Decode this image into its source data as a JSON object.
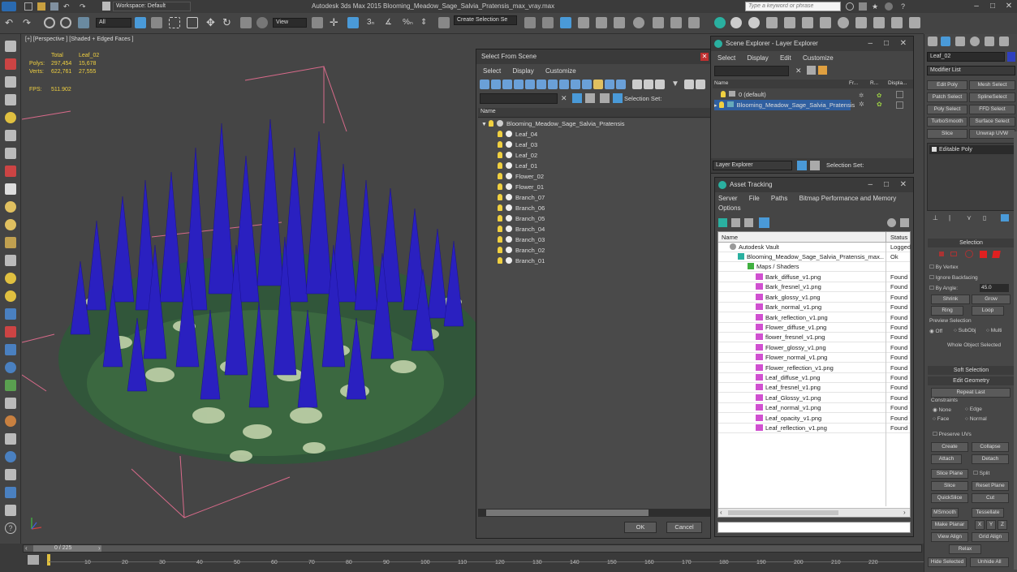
{
  "window": {
    "title": "Autodesk 3ds Max  2015     Blooming_Meadow_Sage_Salvia_Pratensis_max_vray.max",
    "search_placeholder": "Type a keyword or phrase",
    "workspace": "Workspace: Default"
  },
  "toolbar": {
    "filter_value": "All",
    "view_value": "View",
    "selection_set_placeholder": "Create Selection Se"
  },
  "viewport": {
    "label": "[+] [Perspective ] [Shaded + Edged Faces ]",
    "stats": {
      "total_header": "Total",
      "object_header": "Leaf_02",
      "polys_label": "Polys:",
      "polys_total": "297,454",
      "polys_object": "15,678",
      "verts_label": "Verts:",
      "verts_total": "622,761",
      "verts_object": "27,555",
      "fps_label": "FPS:",
      "fps_value": "511.902"
    }
  },
  "select_from_scene": {
    "title": "Select From Scene",
    "menu": [
      "Select",
      "Display",
      "Customize"
    ],
    "selection_set_label": "Selection Set:",
    "column_name": "Name",
    "root": "Blooming_Meadow_Sage_Salvia_Pratensis",
    "items": [
      "Leaf_04",
      "Leaf_03",
      "Leaf_02",
      "Leaf_01",
      "Flower_02",
      "Flower_01",
      "Branch_07",
      "Branch_06",
      "Branch_05",
      "Branch_04",
      "Branch_03",
      "Branch_02",
      "Branch_01"
    ],
    "ok": "OK",
    "cancel": "Cancel"
  },
  "scene_explorer": {
    "title": "Scene Explorer - Layer Explorer",
    "menu": [
      "Select",
      "Display",
      "Edit",
      "Customize"
    ],
    "col_name": "Name",
    "col_fr": "Fr...",
    "col_r": "R...",
    "col_disp": "Displa...",
    "rows": [
      "0 (default)",
      "Blooming_Meadow_Sage_Salvia_Pratensis"
    ],
    "footer_dropdown": "Layer Explorer",
    "selection_set_label": "Selection Set:"
  },
  "asset_tracking": {
    "title": "Asset Tracking",
    "menu": [
      "Server",
      "File",
      "Paths",
      "Bitmap Performance and Memory"
    ],
    "menu2": "Options",
    "col_name": "Name",
    "col_status": "Status",
    "vault": {
      "name": "Autodesk Vault",
      "status": "Logged"
    },
    "file": {
      "name": "Blooming_Meadow_Sage_Salvia_Pratensis_max...",
      "status": "Ok"
    },
    "maps_label": "Maps / Shaders",
    "maps": [
      {
        "name": "Bark_diffuse_v1.png",
        "status": "Found"
      },
      {
        "name": "Bark_fresnel_v1.png",
        "status": "Found"
      },
      {
        "name": "Bark_glossy_v1.png",
        "status": "Found"
      },
      {
        "name": "Bark_normal_v1.png",
        "status": "Found"
      },
      {
        "name": "Bark_reflection_v1.png",
        "status": "Found"
      },
      {
        "name": "Flower_diffuse_v1.png",
        "status": "Found"
      },
      {
        "name": "flower_fresnel_v1.png",
        "status": "Found"
      },
      {
        "name": "Flower_glossy_v1.png",
        "status": "Found"
      },
      {
        "name": "Flower_normal_v1.png",
        "status": "Found"
      },
      {
        "name": "Flower_reflection_v1.png",
        "status": "Found"
      },
      {
        "name": "Leaf_diffuse_v1.png",
        "status": "Found"
      },
      {
        "name": "Leaf_fresnel_v1.png",
        "status": "Found"
      },
      {
        "name": "Leaf_Glossy_v1.png",
        "status": "Found"
      },
      {
        "name": "Leaf_normal_v1.png",
        "status": "Found"
      },
      {
        "name": "Leaf_opacity_v1.png",
        "status": "Found"
      },
      {
        "name": "Leaf_reflection_v1.png",
        "status": "Found"
      }
    ]
  },
  "command_panel": {
    "object_name": "Leaf_02",
    "modifier_list": "Modifier List",
    "mod_buttons": [
      "Edit Poly",
      "Mesh Select",
      "Patch Select",
      "SplineSelect",
      "Poly Select",
      "FFD Select",
      "TurboSmooth",
      "Surface Select",
      "Slice",
      "Unwrap UVW"
    ],
    "stack_item": "Editable Poly",
    "selection_rollout": "Selection",
    "by_vertex": "By Vertex",
    "ignore_backfacing": "Ignore Backfacing",
    "by_angle": "By Angle:",
    "angle_value": "45.0",
    "shrink": "Shrink",
    "grow": "Grow",
    "ring": "Ring",
    "loop": "Loop",
    "preview_selection": "Preview Selection",
    "preview_off": "Off",
    "preview_subobj": "SubObj",
    "preview_multi": "Multi",
    "whole_object": "Whole Object Selected",
    "soft_selection": "Soft Selection",
    "edit_geometry": "Edit Geometry",
    "repeat_last": "Repeat Last",
    "constraints": "Constraints",
    "c_none": "None",
    "c_edge": "Edge",
    "c_face": "Face",
    "c_normal": "Normal",
    "preserve_uvs": "Preserve UVs",
    "create": "Create",
    "collapse": "Collapse",
    "attach": "Attach",
    "detach": "Detach",
    "slice_plane": "Slice Plane",
    "split": "Split",
    "slice": "Slice",
    "reset_plane": "Reset Plane",
    "quickslice": "QuickSlice",
    "cut": "Cut",
    "msmooth": "MSmooth",
    "tessellate": "Tessellate",
    "make_planar": "Make Planar",
    "x": "X",
    "y": "Y",
    "z": "Z",
    "view_align": "View Align",
    "grid_align": "Grid Align",
    "relax": "Relax",
    "hide_selected": "Hide Selected",
    "unhide_all": "Unhide All"
  },
  "timeline": {
    "frame": "0 / 225",
    "ticks": [
      "10",
      "20",
      "30",
      "40",
      "50",
      "60",
      "70",
      "80",
      "90",
      "100",
      "110",
      "120",
      "130",
      "140",
      "150",
      "160",
      "170",
      "180",
      "190",
      "200",
      "210",
      "220"
    ]
  },
  "colors": {
    "accent": "#4aa0e0",
    "flower": "#2a20c0",
    "leaf": "#2e5a35",
    "found": "#dddddd"
  }
}
